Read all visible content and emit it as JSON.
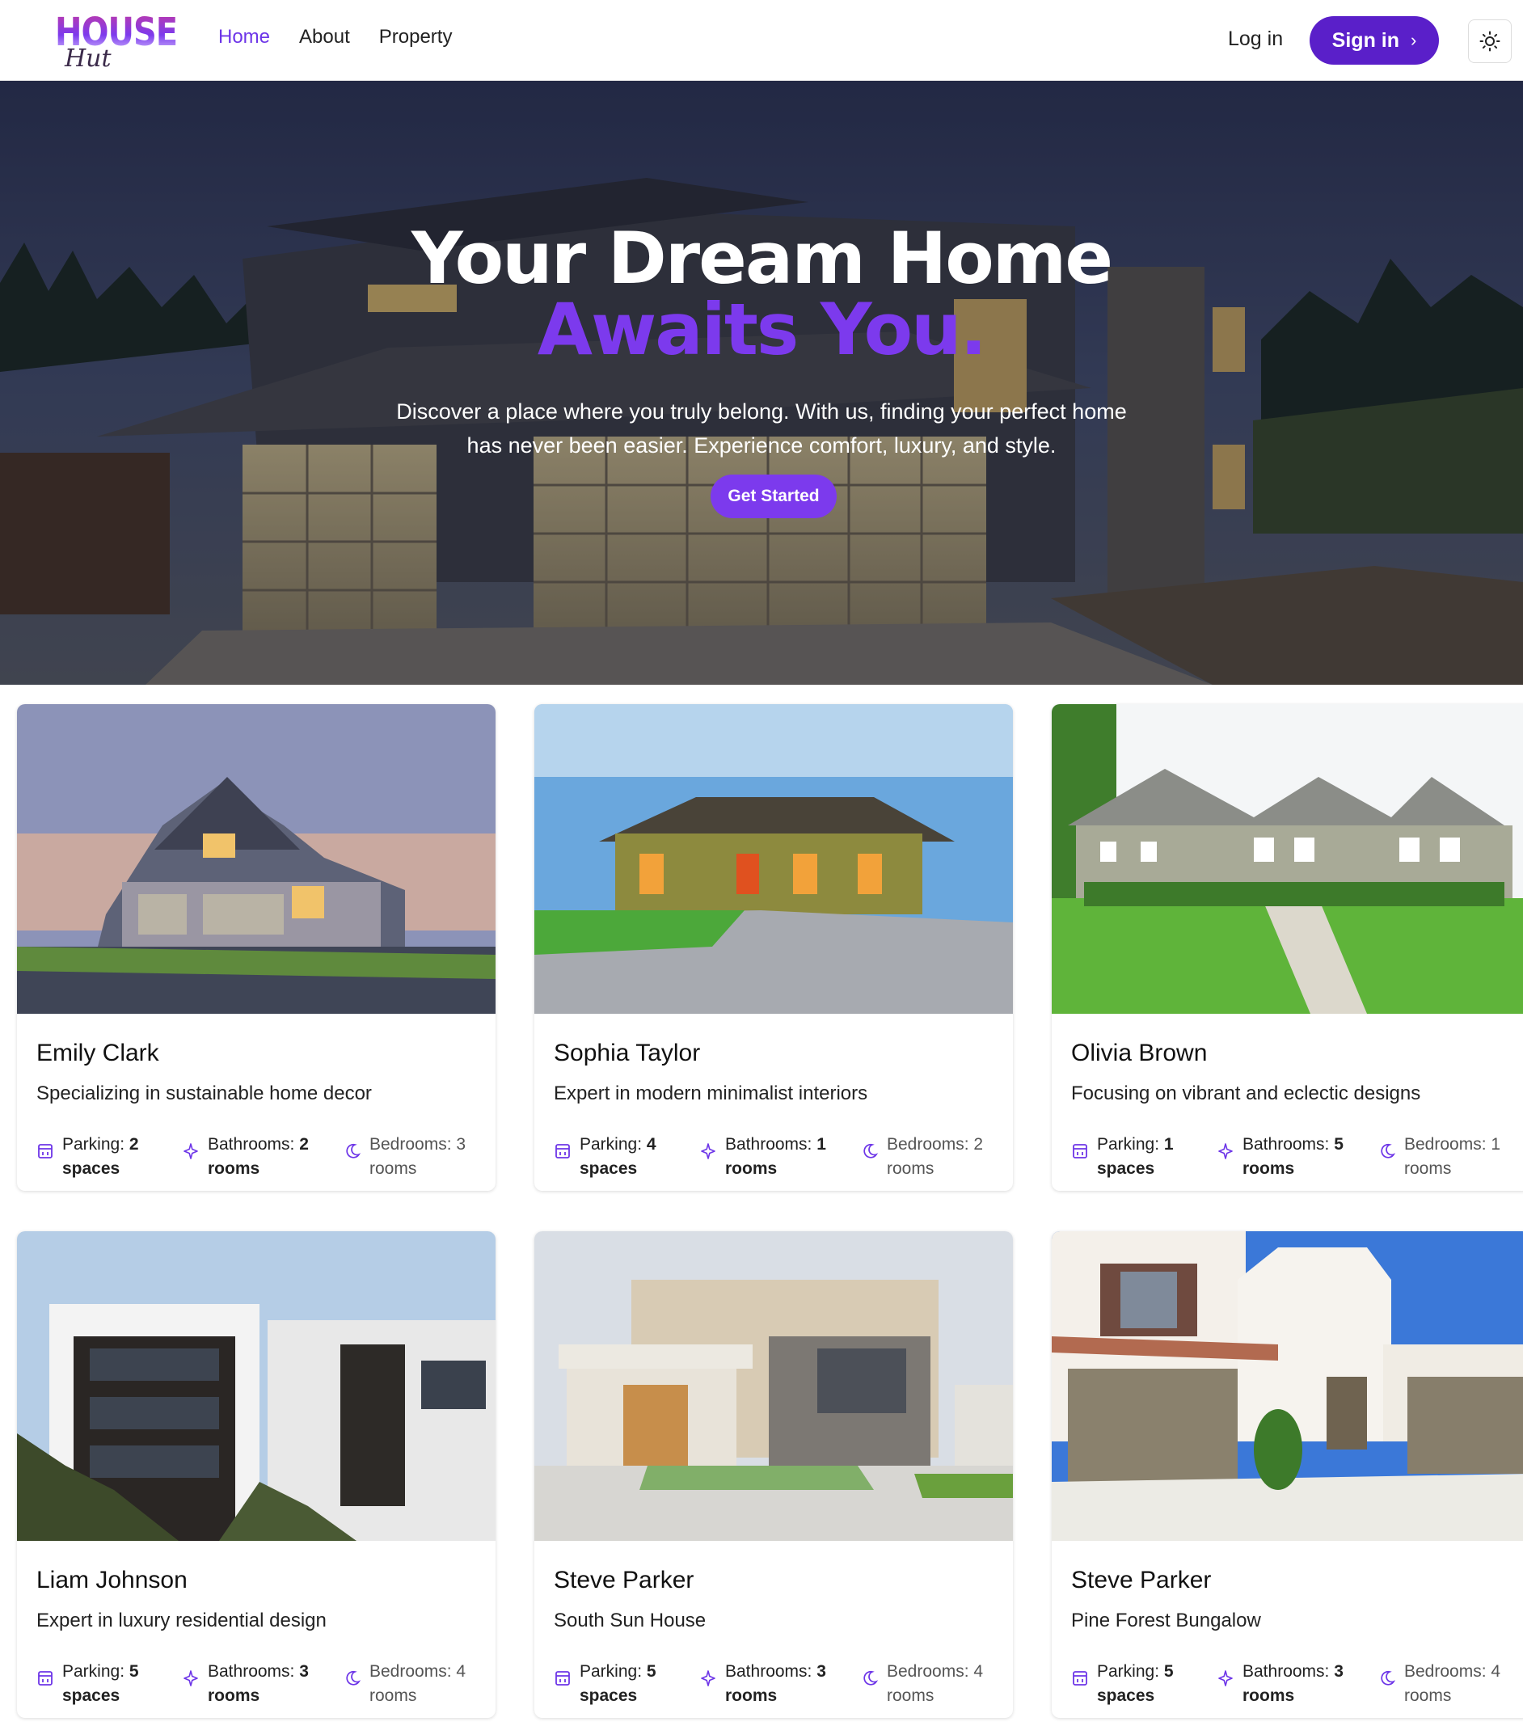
{
  "brand": {
    "logo_word": "HOUSE",
    "logo_script": "Hut"
  },
  "nav": {
    "links": [
      "Home",
      "About",
      "Property"
    ],
    "login": "Log in",
    "signin": "Sign in",
    "signin_icon": "chevron-right-icon",
    "theme_icon": "sun-icon"
  },
  "hero": {
    "title_line1": "Your Dream Home",
    "title_line2": "Awaits You.",
    "subtitle": "Discover a place where you truly belong. With us, finding your perfect home has never been easier. Experience comfort, luxury, and style.",
    "cta": "Get Started"
  },
  "colors": {
    "accent": "#7c3aed",
    "accent_dark": "#5a1fc9"
  },
  "cards": [
    {
      "name": "Emily Clark",
      "desc": "Specializing in sustainable home decor",
      "parking": "2",
      "bathrooms": "2",
      "bedrooms": "3"
    },
    {
      "name": "Sophia Taylor",
      "desc": "Expert in modern minimalist interiors",
      "parking": "4",
      "bathrooms": "1",
      "bedrooms": "2"
    },
    {
      "name": "Olivia Brown",
      "desc": "Focusing on vibrant and eclectic designs",
      "parking": "1",
      "bathrooms": "5",
      "bedrooms": "1"
    },
    {
      "name": "Liam Johnson",
      "desc": "Expert in luxury residential design",
      "parking": "5",
      "bathrooms": "3",
      "bedrooms": "4"
    },
    {
      "name": "Steve Parker",
      "desc": "South Sun House",
      "parking": "5",
      "bathrooms": "3",
      "bedrooms": "4"
    },
    {
      "name": "Steve Parker",
      "desc": "Pine Forest Bungalow",
      "parking": "5",
      "bathrooms": "3",
      "bedrooms": "4"
    }
  ],
  "labels": {
    "parking": "Parking:",
    "bathrooms": "Bathrooms:",
    "bedrooms": "Bedrooms:",
    "spaces": "spaces",
    "rooms": "rooms"
  },
  "icons": {
    "parking": "building-icon",
    "bathrooms": "sparkle-icon",
    "bedrooms": "moon-icon"
  }
}
